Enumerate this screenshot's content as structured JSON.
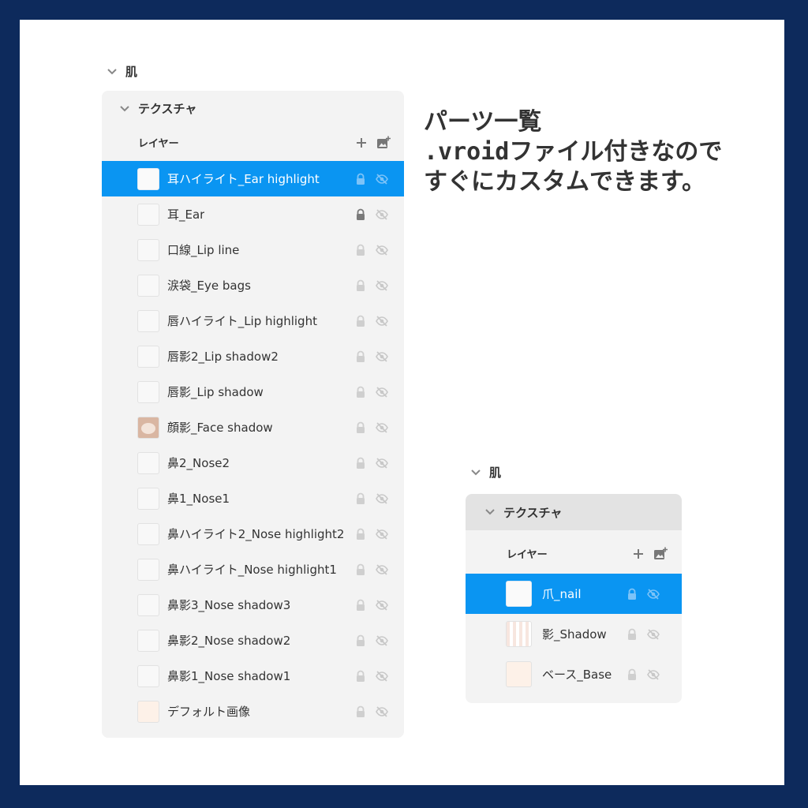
{
  "left_panel": {
    "group_label": "肌",
    "texture_label": "テクスチャ",
    "layers_label": "レイヤー",
    "add_icon": "plus-icon",
    "add_image_icon": "add-image-icon",
    "layers": [
      {
        "label": "耳ハイライト_Ear highlight",
        "selected": true,
        "locked": false,
        "visible": false,
        "thumb": "blank"
      },
      {
        "label": "耳_Ear",
        "selected": false,
        "locked": true,
        "visible": false,
        "thumb": "blank"
      },
      {
        "label": "口線_Lip line",
        "selected": false,
        "locked": false,
        "visible": false,
        "thumb": "blank"
      },
      {
        "label": "涙袋_Eye bags",
        "selected": false,
        "locked": false,
        "visible": false,
        "thumb": "blank"
      },
      {
        "label": "唇ハイライト_Lip highlight",
        "selected": false,
        "locked": false,
        "visible": false,
        "thumb": "blank"
      },
      {
        "label": "唇影2_Lip shadow2",
        "selected": false,
        "locked": false,
        "visible": false,
        "thumb": "blank"
      },
      {
        "label": "唇影_Lip shadow",
        "selected": false,
        "locked": false,
        "visible": false,
        "thumb": "blank"
      },
      {
        "label": "顔影_Face shadow",
        "selected": false,
        "locked": false,
        "visible": false,
        "thumb": "face"
      },
      {
        "label": "鼻2_Nose2",
        "selected": false,
        "locked": false,
        "visible": false,
        "thumb": "blank"
      },
      {
        "label": "鼻1_Nose1",
        "selected": false,
        "locked": false,
        "visible": false,
        "thumb": "blank"
      },
      {
        "label": "鼻ハイライト2_Nose highlight2",
        "selected": false,
        "locked": false,
        "visible": false,
        "thumb": "blank"
      },
      {
        "label": "鼻ハイライト_Nose highlight1",
        "selected": false,
        "locked": false,
        "visible": false,
        "thumb": "blank"
      },
      {
        "label": "鼻影3_Nose shadow3",
        "selected": false,
        "locked": false,
        "visible": false,
        "thumb": "blank"
      },
      {
        "label": "鼻影2_Nose shadow2",
        "selected": false,
        "locked": false,
        "visible": false,
        "thumb": "blank"
      },
      {
        "label": "鼻影1_Nose shadow1",
        "selected": false,
        "locked": false,
        "visible": false,
        "thumb": "blank"
      },
      {
        "label": "デフォルト画像",
        "selected": false,
        "locked": false,
        "visible": false,
        "thumb": "base"
      }
    ]
  },
  "right_panel": {
    "group_label": "肌",
    "texture_label": "テクスチャ",
    "layers_label": "レイヤー",
    "layers": [
      {
        "label": "爪_nail",
        "selected": true,
        "thumb": "blank"
      },
      {
        "label": "影_Shadow",
        "selected": false,
        "thumb": "pattern"
      },
      {
        "label": "ベース_Base",
        "selected": false,
        "thumb": "base"
      }
    ]
  },
  "promo": {
    "line1": "パーツ一覧",
    "line2": ".vroidファイル付きなので",
    "line3": "すぐにカスタムできます。"
  },
  "colors": {
    "frame": "#0d2a5c",
    "selection": "#0a95f2",
    "panel": "#f3f3f3",
    "skin_base": "#fdf1e8"
  }
}
